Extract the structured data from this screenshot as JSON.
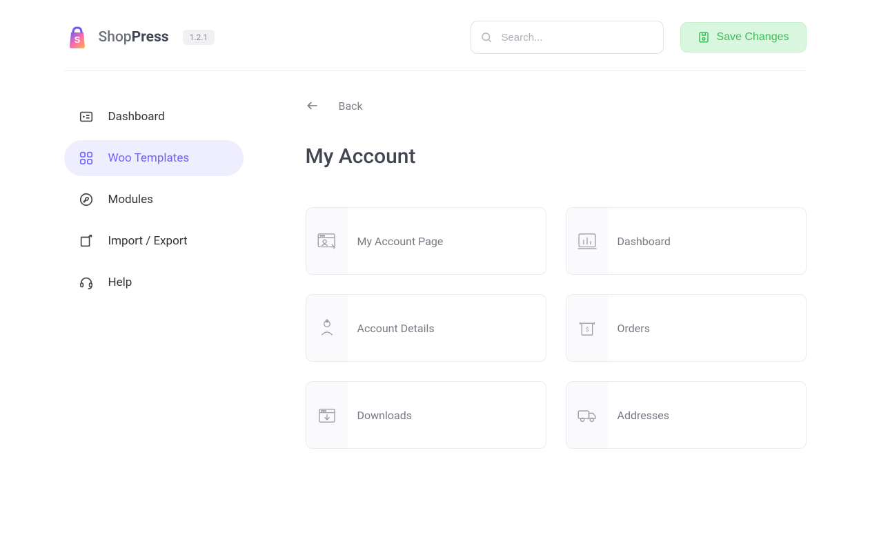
{
  "brand": {
    "name_light": "Shop",
    "name_bold": "Press",
    "version": "1.2.1"
  },
  "header": {
    "search_placeholder": "Search...",
    "save_label": "Save Changes"
  },
  "sidebar": {
    "items": [
      {
        "label": "Dashboard"
      },
      {
        "label": "Woo Templates"
      },
      {
        "label": "Modules"
      },
      {
        "label": "Import / Export"
      },
      {
        "label": "Help"
      }
    ]
  },
  "main": {
    "back_label": "Back",
    "title": "My Account",
    "cards": [
      {
        "label": "My Account Page"
      },
      {
        "label": "Dashboard"
      },
      {
        "label": "Account Details"
      },
      {
        "label": "Orders"
      },
      {
        "label": "Downloads"
      },
      {
        "label": "Addresses"
      }
    ]
  }
}
